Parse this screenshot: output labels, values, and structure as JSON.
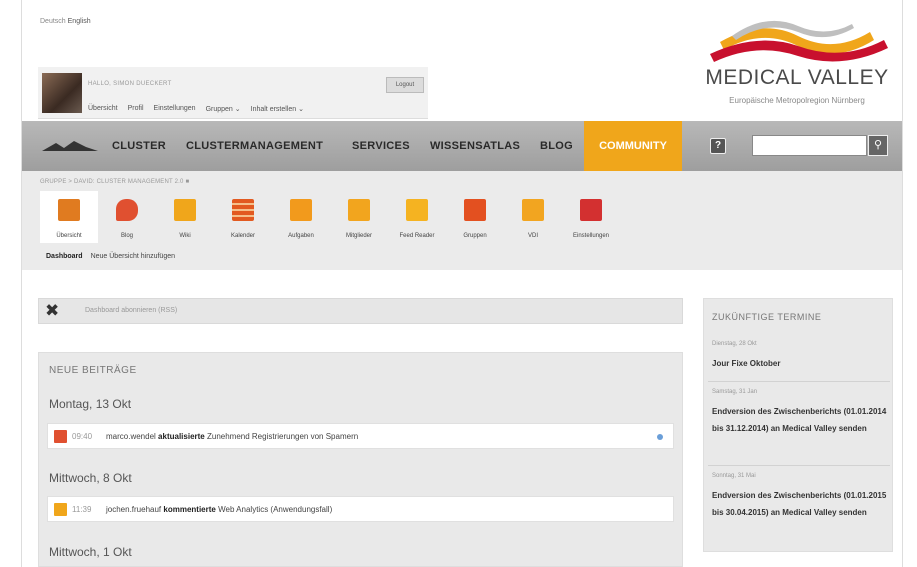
{
  "header": {
    "lang_de": "Deutsch",
    "lang_en": "English",
    "greeting": "HALLO, SIMON DUECKERT",
    "logout": "Logout",
    "user_nav": [
      "Übersicht",
      "Profil",
      "Einstellungen",
      "Gruppen ⌄",
      "Inhalt erstellen ⌄"
    ]
  },
  "logo": {
    "name": "MEDICAL VALLEY",
    "tagline": "Europäische Metropolregion Nürnberg",
    "colors": {
      "red": "#c8102e",
      "orange": "#f0a61b",
      "gray": "#bfbfbf"
    }
  },
  "main_nav": {
    "items": [
      "CLUSTER",
      "CLUSTERMANAGEMENT",
      "SERVICES",
      "WISSENSATLAS",
      "BLOG"
    ],
    "active": "COMMUNITY",
    "help": "?",
    "search_value": "",
    "active_color": "#f0a61b"
  },
  "group": {
    "breadcrumb": "GRUPPE > DAVID: CLUSTER MANAGEMENT 2.0",
    "tools": [
      {
        "label": "Übersicht",
        "icon": "overview-icon",
        "color": "#e07b20"
      },
      {
        "label": "Blog",
        "icon": "blog-icon",
        "color": "#e05030"
      },
      {
        "label": "Wiki",
        "icon": "wiki-icon",
        "color": "#f0a61b"
      },
      {
        "label": "Kalender",
        "icon": "calendar-icon",
        "color": "#e25a20"
      },
      {
        "label": "Aufgaben",
        "icon": "tasks-icon",
        "color": "#f29a1c"
      },
      {
        "label": "Mitglieder",
        "icon": "members-icon",
        "color": "#f2a51e"
      },
      {
        "label": "Feed Reader",
        "icon": "rss-icon",
        "color": "#f5b321"
      },
      {
        "label": "Gruppen",
        "icon": "groups-icon",
        "color": "#e35020"
      },
      {
        "label": "VDI",
        "icon": "chart-icon",
        "color": "#f2a520"
      },
      {
        "label": "Einstellungen",
        "icon": "settings-icon",
        "color": "#d33030"
      }
    ],
    "subtabs": [
      "Dashboard",
      "Neue Übersicht hinzufügen"
    ]
  },
  "dashboard": {
    "rss_label": "Dashboard abonnieren (RSS)",
    "posts_heading": "NEUE BEITRÄGE",
    "days": [
      {
        "label": "Montag, 13 Okt",
        "entries": [
          {
            "time": "09:40",
            "user": "marco.wendel",
            "action": "aktualisierte",
            "target": "Zunehmend Registrierungen von Spamern",
            "icon_color": "#e05030"
          }
        ]
      },
      {
        "label": "Mittwoch, 8 Okt",
        "entries": [
          {
            "time": "11:39",
            "user": "jochen.fruehauf",
            "action": "kommentierte",
            "target": "Web Analytics (Anwendungsfall)",
            "icon_color": "#f0a61b"
          }
        ]
      },
      {
        "label": "Mittwoch, 1 Okt",
        "entries": []
      }
    ]
  },
  "events": {
    "heading": "ZUKÜNFTIGE TERMINE",
    "items": [
      {
        "date": "Dienstag, 28 Okt",
        "title": "Jour Fixe Oktober"
      },
      {
        "date": "Samstag, 31 Jan",
        "title": "Endversion des Zwischenberichts (01.01.2014 bis 31.12.2014) an Medical Valley senden"
      },
      {
        "date": "Sonntag, 31 Mai",
        "title": "Endversion des Zwischenberichts (01.01.2015 bis 30.04.2015) an Medical Valley senden"
      }
    ]
  }
}
